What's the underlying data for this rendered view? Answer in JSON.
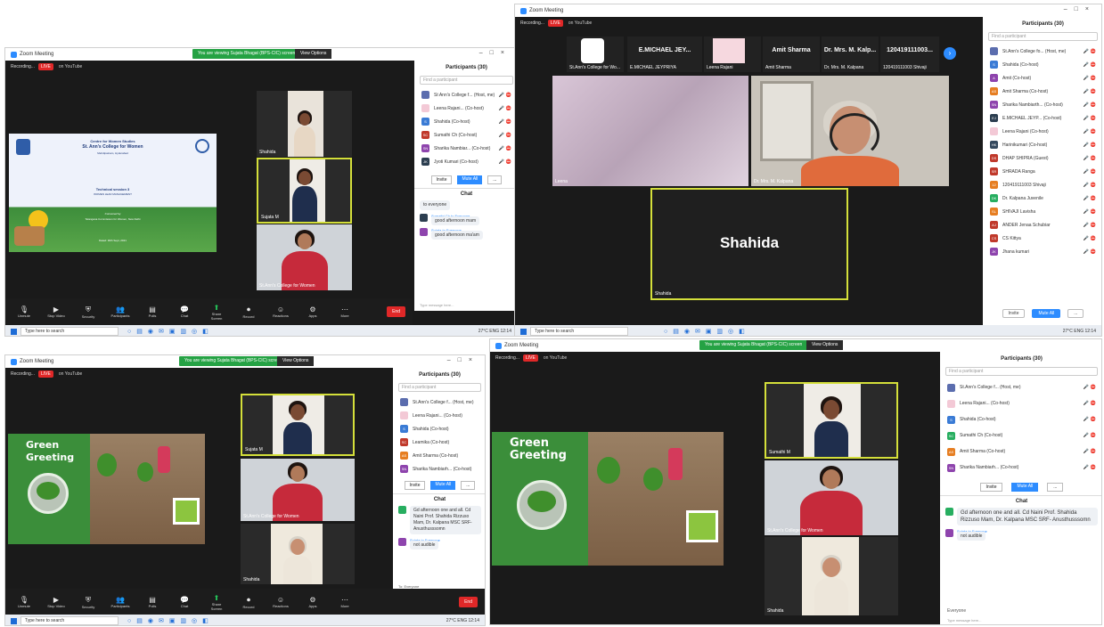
{
  "windows": {
    "topleft": {
      "titlebar": "Zoom Meeting",
      "banner_text": "You are viewing Sujata Bhagat (BPS-CIC) screen",
      "banner_options": "View Options",
      "recording": "Recording...",
      "rec_badge": "LIVE",
      "view_label": "on YouTube",
      "slide": {
        "center": "Centre for Women Studies",
        "college": "St. Ann's College for Women",
        "address": "Mehdipatnam, Hyderabad",
        "session": "Technical session 3",
        "topic": "WOMEN LEAD MANAGEMENT",
        "convened_by": "Convened by",
        "convener": "Telangana Commission for Women, New Delhi",
        "date": "Dated: 30th Sept, 2021"
      },
      "tiles": [
        {
          "name": "Shahida"
        },
        {
          "name": "Sujata M"
        },
        {
          "name": "St.Ann's College for Women"
        }
      ],
      "participants_title": "Participants (30)",
      "search_placeholder": "Find a participant",
      "participants": [
        {
          "name": "St Ann's College f... (Host, me)",
          "initials": "",
          "color": "#5b6dae"
        },
        {
          "name": "Leena Rajani... (Co-host)",
          "initials": "",
          "color": "#f3c9d6"
        },
        {
          "name": "Shahida (Co-host)",
          "initials": "S",
          "color": "#3a7bd5"
        },
        {
          "name": "Sumathi Ch (Co-host)",
          "initials": "SC",
          "color": "#c0392b"
        },
        {
          "name": "Sharika Nambiar... (Co-host)",
          "initials": "SN",
          "color": "#8e44ad"
        },
        {
          "name": "Jyoti Kumari (Co-host)",
          "initials": "JK",
          "color": "#2c3e50"
        }
      ],
      "panel_buttons": [
        "Invite",
        "Mute All",
        "..."
      ],
      "chat_title": "Chat",
      "chat": [
        {
          "from": "to Everyone",
          "text": "to everyone"
        },
        {
          "from": "Sumathi Ch to Everyone",
          "text": "good afternoon mam"
        },
        {
          "from": "Sujata to Everyone",
          "text": "good afternoon ma'am"
        }
      ],
      "chat_input": "Type message here...",
      "toolbar": [
        "Unmute",
        "Stop Video",
        "Security",
        "Participants",
        "Polls",
        "Chat",
        "Share Screen",
        "Record",
        "Reactions",
        "Apps",
        "More"
      ],
      "end_label": "End",
      "taskbar_search": "Type here to search",
      "clock": "27°C  ENG  12:14"
    },
    "topright": {
      "titlebar": "Zoom Meeting",
      "recording": "Recording...",
      "rec_badge": "LIVE",
      "view_label": "on YouTube",
      "strip": [
        {
          "name": "E.MICHAEL JEY...",
          "caption": "E.MICHAEL JEYPRIYA"
        },
        {
          "name": "",
          "caption": "Leena Rajani"
        },
        {
          "name": "Amit Sharma",
          "caption": "Amit Sharma"
        },
        {
          "name": "Dr. Mrs. M. Kalp...",
          "caption": "Dr. Mrs. M. Kalpana"
        },
        {
          "name": "120419111003...",
          "caption": "120419111003 Shivaji"
        }
      ],
      "strip_first_caption": "St.Ann's College for Wo...",
      "big_tiles": [
        {
          "name": "Leena"
        },
        {
          "name": "Dr. Mrs. M. Kalpana"
        }
      ],
      "speaker_tile": "Shahida",
      "speaker_label": "Shahida",
      "participants_title": "Participants (30)",
      "search_placeholder": "Find a participant",
      "participants": [
        {
          "name": "St.Ann's College fo... (Host, me)",
          "initials": "",
          "color": "#5b6dae"
        },
        {
          "name": "Shahida (Co-host)",
          "initials": "S",
          "color": "#3a7bd5"
        },
        {
          "name": "Amit (Co-host)",
          "initials": "A",
          "color": "#8e44ad"
        },
        {
          "name": "Amit Sharma (Co-host)",
          "initials": "AS",
          "color": "#e67e22"
        },
        {
          "name": "Sharika Nambiarth... (Co-host)",
          "initials": "SN",
          "color": "#8e44ad"
        },
        {
          "name": "E.MICHAEL JEYP... (Co-host)",
          "initials": "EJ",
          "color": "#2c3e50"
        },
        {
          "name": "Leena Rajani (Co-host)",
          "initials": "",
          "color": "#f3c9d6"
        },
        {
          "name": "Harinikumari (Co-host)",
          "initials": "HK",
          "color": "#34495e"
        },
        {
          "name": "DHAP SHIPRA (Guest)",
          "initials": "DS",
          "color": "#c0392b"
        },
        {
          "name": "SHRADA Ranga",
          "initials": "SR",
          "color": "#c0392b"
        },
        {
          "name": "120419111003 Shivaji",
          "initials": "12",
          "color": "#e67e22"
        },
        {
          "name": "Dr. Kalpana Juvenile",
          "initials": "DK",
          "color": "#27ae60"
        },
        {
          "name": "SHIVAJI Lavisha",
          "initials": "SL",
          "color": "#e67e22"
        },
        {
          "name": "ANDER Jenaa Schubiar",
          "initials": "AJ",
          "color": "#c0392b"
        },
        {
          "name": "CS Kittya",
          "initials": "CS",
          "color": "#c0392b"
        },
        {
          "name": "Jhana kumari",
          "initials": "JK",
          "color": "#8e44ad"
        }
      ],
      "panel_buttons": [
        "Invite",
        "Mute All",
        "..."
      ],
      "taskbar_search": "Type here to search",
      "clock": "27°C  ENG  12:14"
    },
    "bottomleft": {
      "titlebar": "Zoom Meeting",
      "banner_text": "You are viewing Sujata Bhagat (BPS-CIC) screen",
      "banner_options": "View Options",
      "recording": "Recording...",
      "rec_badge": "LIVE",
      "view_label": "on YouTube",
      "slide_title": "Green Greeting",
      "tiles": [
        {
          "name": "Sujata M"
        },
        {
          "name": "St.Ann's College for Women"
        },
        {
          "name": "Shahida"
        }
      ],
      "participants_title": "Participants (30)",
      "search_placeholder": "Find a participant",
      "participants": [
        {
          "name": "St.Ann's College f... (Host, me)",
          "initials": "",
          "color": "#5b6dae"
        },
        {
          "name": "Leena Rajani... (Co-host)",
          "initials": "",
          "color": "#f3c9d6"
        },
        {
          "name": "Shahida (Co-host)",
          "initials": "S",
          "color": "#3a7bd5"
        },
        {
          "name": "Leamika (Co-host)",
          "initials": "SC",
          "color": "#c0392b"
        },
        {
          "name": "Amit Sharma (Co-host)",
          "initials": "AS",
          "color": "#e67e22"
        },
        {
          "name": "Sharika Nambiarh... (Co-host)",
          "initials": "SN",
          "color": "#8e44ad"
        }
      ],
      "panel_buttons": [
        "Invite",
        "Mute All",
        "..."
      ],
      "chat_title": "Chat",
      "chat": [
        {
          "from": "",
          "text": "Gd afternoon one and all. Cd Naini Prof. Shahida Rizzuso Mam, Dr. Kalpana MSC SRF- Anusthusssomn"
        },
        {
          "from": "Sujata to Everyone",
          "text": "not audible"
        }
      ],
      "chat_to": "To: Everyone",
      "chat_input": "Type message here...",
      "toolbar": [
        "Unmute",
        "Stop Video",
        "Security",
        "Participants",
        "Polls",
        "Chat",
        "Share Screen",
        "Record",
        "Reactions",
        "Apps",
        "More"
      ],
      "end_label": "End",
      "taskbar_search": "Type here to search",
      "clock": "27°C  ENG  12:14"
    },
    "bottomright": {
      "titlebar": "Zoom Meeting",
      "banner_text": "You are viewing Sujata Bhagat (BPS-CIC) screen",
      "banner_options": "View Options",
      "recording": "Recording...",
      "rec_badge": "LIVE",
      "view_label": "on YouTube",
      "slide_title": "Green Greeting",
      "tiles": [
        {
          "name": "Sumathi M"
        },
        {
          "name": "St.Ann's College for Women"
        },
        {
          "name": "Shahida"
        }
      ],
      "participants_title": "Participants (30)",
      "search_placeholder": "Find a participant",
      "participants": [
        {
          "name": "St.Ann's College f... (Host, me)",
          "initials": "",
          "color": "#5b6dae"
        },
        {
          "name": "Leena Rajani... (Co-host)",
          "initials": "",
          "color": "#f3c9d6"
        },
        {
          "name": "Shahida (Co-host)",
          "initials": "S",
          "color": "#3a7bd5"
        },
        {
          "name": "Sumathi Ch (Co-host)",
          "initials": "SC",
          "color": "#27ae60"
        },
        {
          "name": "Amit Sharma (Co-host)",
          "initials": "AS",
          "color": "#e67e22"
        },
        {
          "name": "Sharika Nambiarh... (Co-host)",
          "initials": "SN",
          "color": "#8e44ad"
        }
      ],
      "panel_buttons": [
        "Invite",
        "Mute All",
        "..."
      ],
      "chat_title": "Chat",
      "chat": [
        {
          "from": "",
          "text": "Gd afternoon one and all. Cd Naini Prof. Shahida Rizzuso Mam, Dr. Kalpana MSC SRF- Anusthusssomn"
        },
        {
          "from": "Sujata to Everyone",
          "text": "not audible"
        }
      ],
      "chat_to": "Everyone",
      "chat_input": "Type message here..."
    }
  },
  "colors": {
    "zoom_bg": "#1a1a1a",
    "active_speaker": "#d4df3a",
    "zoom_blue": "#2d8cff",
    "end_red": "#e02828",
    "banner_green": "#25a244",
    "greeting_green": "#3b8e3a"
  }
}
